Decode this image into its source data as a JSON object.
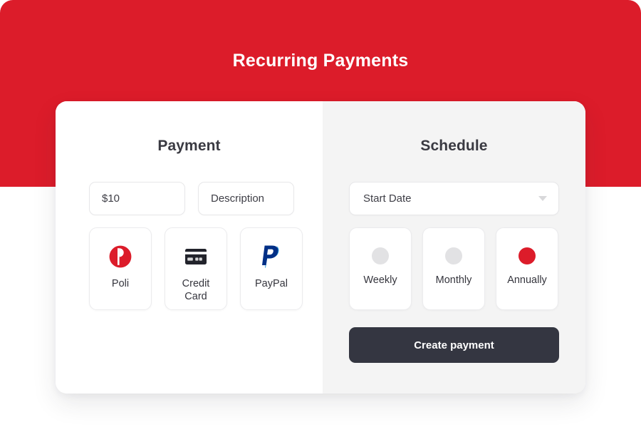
{
  "header": {
    "title": "Recurring Payments",
    "background_color": "#DC1C2A"
  },
  "card": {
    "payment_panel": {
      "heading": "Payment",
      "amount_field": {
        "value": "$10",
        "placeholder": "$10"
      },
      "description_field": {
        "value": "Description",
        "placeholder": "Description"
      },
      "methods": [
        {
          "label": "Poli",
          "icon": "poli-logo-icon",
          "selected": false,
          "color": "#DC1C2A"
        },
        {
          "label": "Credit\nCard",
          "label_line1": "Credit",
          "label_line2": "Card",
          "icon": "credit-card-icon",
          "selected": false,
          "color": "#22232B"
        },
        {
          "label": "PayPal",
          "icon": "paypal-logo-icon",
          "selected": false,
          "color": "#002F86"
        }
      ]
    },
    "schedule_panel": {
      "heading": "Schedule",
      "start_date_select": {
        "value": "Start Date",
        "placeholder": "Start Date",
        "caret_icon": "chevron-down-icon"
      },
      "frequencies": [
        {
          "label": "Weekly",
          "selected": false
        },
        {
          "label": "Monthly",
          "selected": false
        },
        {
          "label": "Annually",
          "selected": true
        }
      ],
      "submit_label": "Create payment",
      "submit_color": "#343641",
      "selected_color": "#DC1C2A"
    }
  }
}
